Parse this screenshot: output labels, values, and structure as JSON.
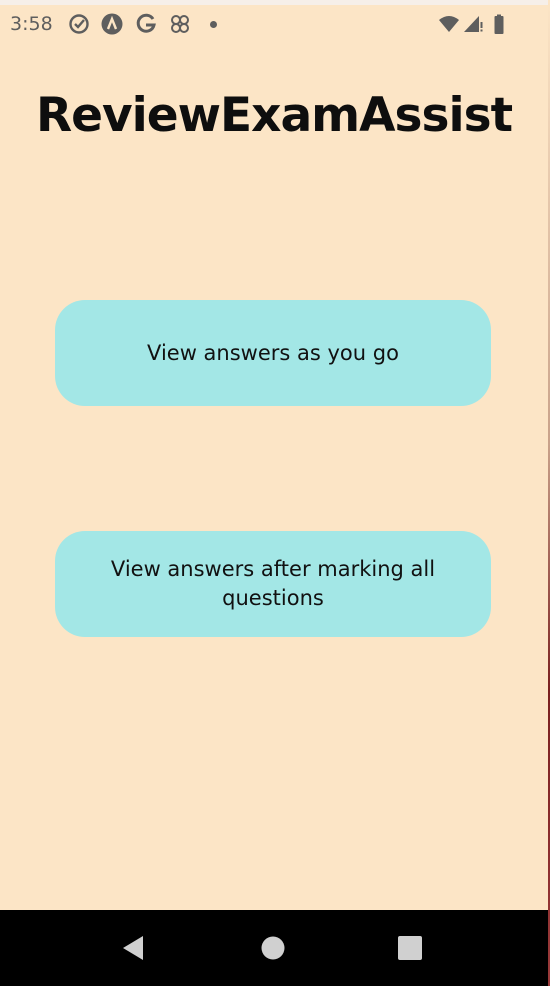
{
  "status_bar": {
    "time": "3:58",
    "left_icons": [
      "check-circle-icon",
      "android-studio-icon",
      "google-icon",
      "pinwheel-icon",
      "notification-dot-icon"
    ],
    "right_icons": [
      "wifi-icon",
      "signal-icon",
      "battery-icon"
    ]
  },
  "app": {
    "title": "ReviewExamAssist"
  },
  "buttons": {
    "view_as_you_go": "View answers as you go",
    "view_after_marking": "View answers after marking all questions"
  },
  "nav_bar": {
    "icons": [
      "back-icon",
      "home-icon",
      "recents-icon"
    ]
  },
  "colors": {
    "background": "#fce5c6",
    "button": "#a3e7e6",
    "title_text": "#0e0e0e",
    "nav_bar": "#000000"
  }
}
